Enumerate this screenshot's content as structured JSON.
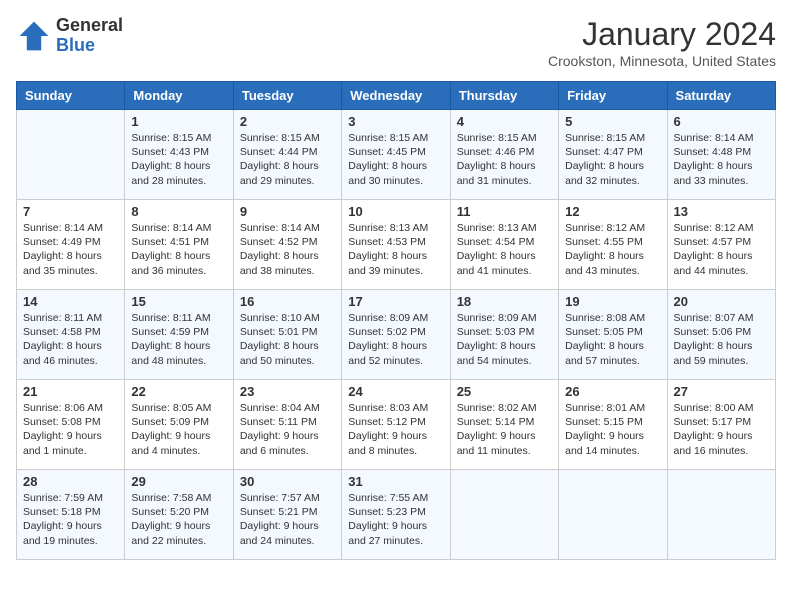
{
  "logo": {
    "general": "General",
    "blue": "Blue"
  },
  "title": "January 2024",
  "location": "Crookston, Minnesota, United States",
  "days_of_week": [
    "Sunday",
    "Monday",
    "Tuesday",
    "Wednesday",
    "Thursday",
    "Friday",
    "Saturday"
  ],
  "weeks": [
    [
      {
        "day": "",
        "info": ""
      },
      {
        "day": "1",
        "info": "Sunrise: 8:15 AM\nSunset: 4:43 PM\nDaylight: 8 hours\nand 28 minutes."
      },
      {
        "day": "2",
        "info": "Sunrise: 8:15 AM\nSunset: 4:44 PM\nDaylight: 8 hours\nand 29 minutes."
      },
      {
        "day": "3",
        "info": "Sunrise: 8:15 AM\nSunset: 4:45 PM\nDaylight: 8 hours\nand 30 minutes."
      },
      {
        "day": "4",
        "info": "Sunrise: 8:15 AM\nSunset: 4:46 PM\nDaylight: 8 hours\nand 31 minutes."
      },
      {
        "day": "5",
        "info": "Sunrise: 8:15 AM\nSunset: 4:47 PM\nDaylight: 8 hours\nand 32 minutes."
      },
      {
        "day": "6",
        "info": "Sunrise: 8:14 AM\nSunset: 4:48 PM\nDaylight: 8 hours\nand 33 minutes."
      }
    ],
    [
      {
        "day": "7",
        "info": "Sunrise: 8:14 AM\nSunset: 4:49 PM\nDaylight: 8 hours\nand 35 minutes."
      },
      {
        "day": "8",
        "info": "Sunrise: 8:14 AM\nSunset: 4:51 PM\nDaylight: 8 hours\nand 36 minutes."
      },
      {
        "day": "9",
        "info": "Sunrise: 8:14 AM\nSunset: 4:52 PM\nDaylight: 8 hours\nand 38 minutes."
      },
      {
        "day": "10",
        "info": "Sunrise: 8:13 AM\nSunset: 4:53 PM\nDaylight: 8 hours\nand 39 minutes."
      },
      {
        "day": "11",
        "info": "Sunrise: 8:13 AM\nSunset: 4:54 PM\nDaylight: 8 hours\nand 41 minutes."
      },
      {
        "day": "12",
        "info": "Sunrise: 8:12 AM\nSunset: 4:55 PM\nDaylight: 8 hours\nand 43 minutes."
      },
      {
        "day": "13",
        "info": "Sunrise: 8:12 AM\nSunset: 4:57 PM\nDaylight: 8 hours\nand 44 minutes."
      }
    ],
    [
      {
        "day": "14",
        "info": "Sunrise: 8:11 AM\nSunset: 4:58 PM\nDaylight: 8 hours\nand 46 minutes."
      },
      {
        "day": "15",
        "info": "Sunrise: 8:11 AM\nSunset: 4:59 PM\nDaylight: 8 hours\nand 48 minutes."
      },
      {
        "day": "16",
        "info": "Sunrise: 8:10 AM\nSunset: 5:01 PM\nDaylight: 8 hours\nand 50 minutes."
      },
      {
        "day": "17",
        "info": "Sunrise: 8:09 AM\nSunset: 5:02 PM\nDaylight: 8 hours\nand 52 minutes."
      },
      {
        "day": "18",
        "info": "Sunrise: 8:09 AM\nSunset: 5:03 PM\nDaylight: 8 hours\nand 54 minutes."
      },
      {
        "day": "19",
        "info": "Sunrise: 8:08 AM\nSunset: 5:05 PM\nDaylight: 8 hours\nand 57 minutes."
      },
      {
        "day": "20",
        "info": "Sunrise: 8:07 AM\nSunset: 5:06 PM\nDaylight: 8 hours\nand 59 minutes."
      }
    ],
    [
      {
        "day": "21",
        "info": "Sunrise: 8:06 AM\nSunset: 5:08 PM\nDaylight: 9 hours\nand 1 minute."
      },
      {
        "day": "22",
        "info": "Sunrise: 8:05 AM\nSunset: 5:09 PM\nDaylight: 9 hours\nand 4 minutes."
      },
      {
        "day": "23",
        "info": "Sunrise: 8:04 AM\nSunset: 5:11 PM\nDaylight: 9 hours\nand 6 minutes."
      },
      {
        "day": "24",
        "info": "Sunrise: 8:03 AM\nSunset: 5:12 PM\nDaylight: 9 hours\nand 8 minutes."
      },
      {
        "day": "25",
        "info": "Sunrise: 8:02 AM\nSunset: 5:14 PM\nDaylight: 9 hours\nand 11 minutes."
      },
      {
        "day": "26",
        "info": "Sunrise: 8:01 AM\nSunset: 5:15 PM\nDaylight: 9 hours\nand 14 minutes."
      },
      {
        "day": "27",
        "info": "Sunrise: 8:00 AM\nSunset: 5:17 PM\nDaylight: 9 hours\nand 16 minutes."
      }
    ],
    [
      {
        "day": "28",
        "info": "Sunrise: 7:59 AM\nSunset: 5:18 PM\nDaylight: 9 hours\nand 19 minutes."
      },
      {
        "day": "29",
        "info": "Sunrise: 7:58 AM\nSunset: 5:20 PM\nDaylight: 9 hours\nand 22 minutes."
      },
      {
        "day": "30",
        "info": "Sunrise: 7:57 AM\nSunset: 5:21 PM\nDaylight: 9 hours\nand 24 minutes."
      },
      {
        "day": "31",
        "info": "Sunrise: 7:55 AM\nSunset: 5:23 PM\nDaylight: 9 hours\nand 27 minutes."
      },
      {
        "day": "",
        "info": ""
      },
      {
        "day": "",
        "info": ""
      },
      {
        "day": "",
        "info": ""
      }
    ]
  ]
}
